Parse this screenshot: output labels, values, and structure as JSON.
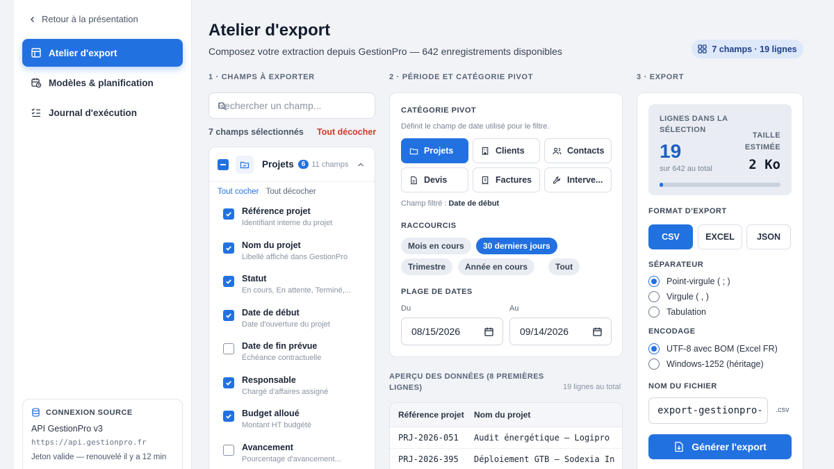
{
  "sidebar": {
    "back_label": "Retour à la présentation",
    "items": [
      {
        "label": "Atelier d'export",
        "icon": "table-icon",
        "active": true
      },
      {
        "label": "Modèles & planification",
        "icon": "calendar-clock-icon",
        "active": false
      },
      {
        "label": "Journal d'exécution",
        "icon": "list-check-icon",
        "active": false
      }
    ],
    "source": {
      "heading": "CONNEXION SOURCE",
      "name": "API GestionPro v3",
      "url": "https://api.gestionpro.fr",
      "token": "Jeton valide — renouvelé il y a 12 min"
    }
  },
  "header": {
    "title": "Atelier d'export",
    "subtitle": "Composez votre extraction depuis GestionPro — 642 enregistrements disponibles",
    "pill": "7 champs · 19 lignes"
  },
  "fields": {
    "heading": "1 · CHAMPS À EXPORTER",
    "search_placeholder": "Rechercher un champ...",
    "selected_count": "7 champs sélectionnés",
    "clear_all": "Tout décocher",
    "group": {
      "title": "Projets",
      "badge": "6",
      "count": "11 champs",
      "check_all": "Tout cocher",
      "uncheck_all": "Tout décocher",
      "items": [
        {
          "name": "Référence projet",
          "desc": "Identifiant interne du projet",
          "checked": true
        },
        {
          "name": "Nom du projet",
          "desc": "Libellé affiché dans GestionPro",
          "checked": true
        },
        {
          "name": "Statut",
          "desc": "En cours, En attente, Terminé,...",
          "checked": true
        },
        {
          "name": "Date de début",
          "desc": "Date d'ouverture du projet",
          "checked": true
        },
        {
          "name": "Date de fin prévue",
          "desc": "Échéance contractuelle",
          "checked": false
        },
        {
          "name": "Responsable",
          "desc": "Chargé d'affaires assigné",
          "checked": true
        },
        {
          "name": "Budget alloué",
          "desc": "Montant HT budgété",
          "checked": true
        },
        {
          "name": "Avancement",
          "desc": "Pourcentage d'avancement...",
          "checked": false
        }
      ]
    }
  },
  "period": {
    "heading": "2 · PÉRIODE ET CATÉGORIE PIVOT",
    "pivot_label": "CATÉGORIE PIVOT",
    "pivot_hint": "Définit le champ de date utilisé pour le filtre.",
    "categories": [
      {
        "label": "Projets",
        "icon": "folder-icon",
        "active": true
      },
      {
        "label": "Clients",
        "icon": "building-icon",
        "active": false
      },
      {
        "label": "Contacts",
        "icon": "users-icon",
        "active": false
      },
      {
        "label": "Devis",
        "icon": "file-icon",
        "active": false
      },
      {
        "label": "Factures",
        "icon": "receipt-icon",
        "active": false
      },
      {
        "label": "Interve...",
        "icon": "wrench-icon",
        "active": false
      }
    ],
    "filtered_prefix": "Champ filtré : ",
    "filtered_value": "Date de début",
    "shortcuts_label": "RACCOURCIS",
    "shortcuts": [
      {
        "label": "Mois en cours",
        "active": false
      },
      {
        "label": "30 derniers jours",
        "active": true
      },
      {
        "label": "Trimestre",
        "active": false
      },
      {
        "label": "Année en cours",
        "active": false
      },
      {
        "label": "Tout",
        "active": false
      }
    ],
    "range_label": "PLAGE DE DATES",
    "from_label": "Du",
    "to_label": "Au",
    "from_value": "08/15/2026",
    "to_value": "09/14/2026"
  },
  "preview": {
    "heading": "APERÇU DES DONNÉES (8 PREMIÈRES LIGNES)",
    "total": "19 lignes au total",
    "columns": [
      "Référence projet",
      "Nom du projet"
    ],
    "rows": [
      [
        "PRJ-2026-051",
        "Audit énergétique — Logipro"
      ],
      [
        "PRJ-2026-395",
        "Déploiement GTB — Sodexia In"
      ]
    ]
  },
  "export": {
    "heading": "3 · EXPORT",
    "lines_label": "LIGNES DANS LA SÉLECTION",
    "lines_value": "19",
    "lines_sub": "sur 642 au total",
    "size_label": "TAILLE ESTIMÉE",
    "size_value": "2 Ko",
    "progress": 0.03,
    "format_label": "FORMAT D'EXPORT",
    "formats": [
      {
        "label": "CSV",
        "active": true
      },
      {
        "label": "EXCEL",
        "active": false
      },
      {
        "label": "JSON",
        "active": false
      }
    ],
    "separator_label": "SÉPARATEUR",
    "separators": [
      {
        "label": "Point-virgule ( ; )",
        "checked": true
      },
      {
        "label": "Virgule ( , )",
        "checked": false
      },
      {
        "label": "Tabulation",
        "checked": false
      }
    ],
    "encoding_label": "ENCODAGE",
    "encodings": [
      {
        "label": "UTF-8 avec BOM (Excel FR)",
        "checked": true
      },
      {
        "label": "Windows-1252 (héritage)",
        "checked": false
      }
    ],
    "filename_label": "NOM DU FICHIER",
    "filename_value": "export-gestionpro-",
    "extension": ".csv",
    "generate_label": "Générer l'export"
  },
  "colors": {
    "accent": "#2271e0",
    "danger": "#d03a2a"
  }
}
